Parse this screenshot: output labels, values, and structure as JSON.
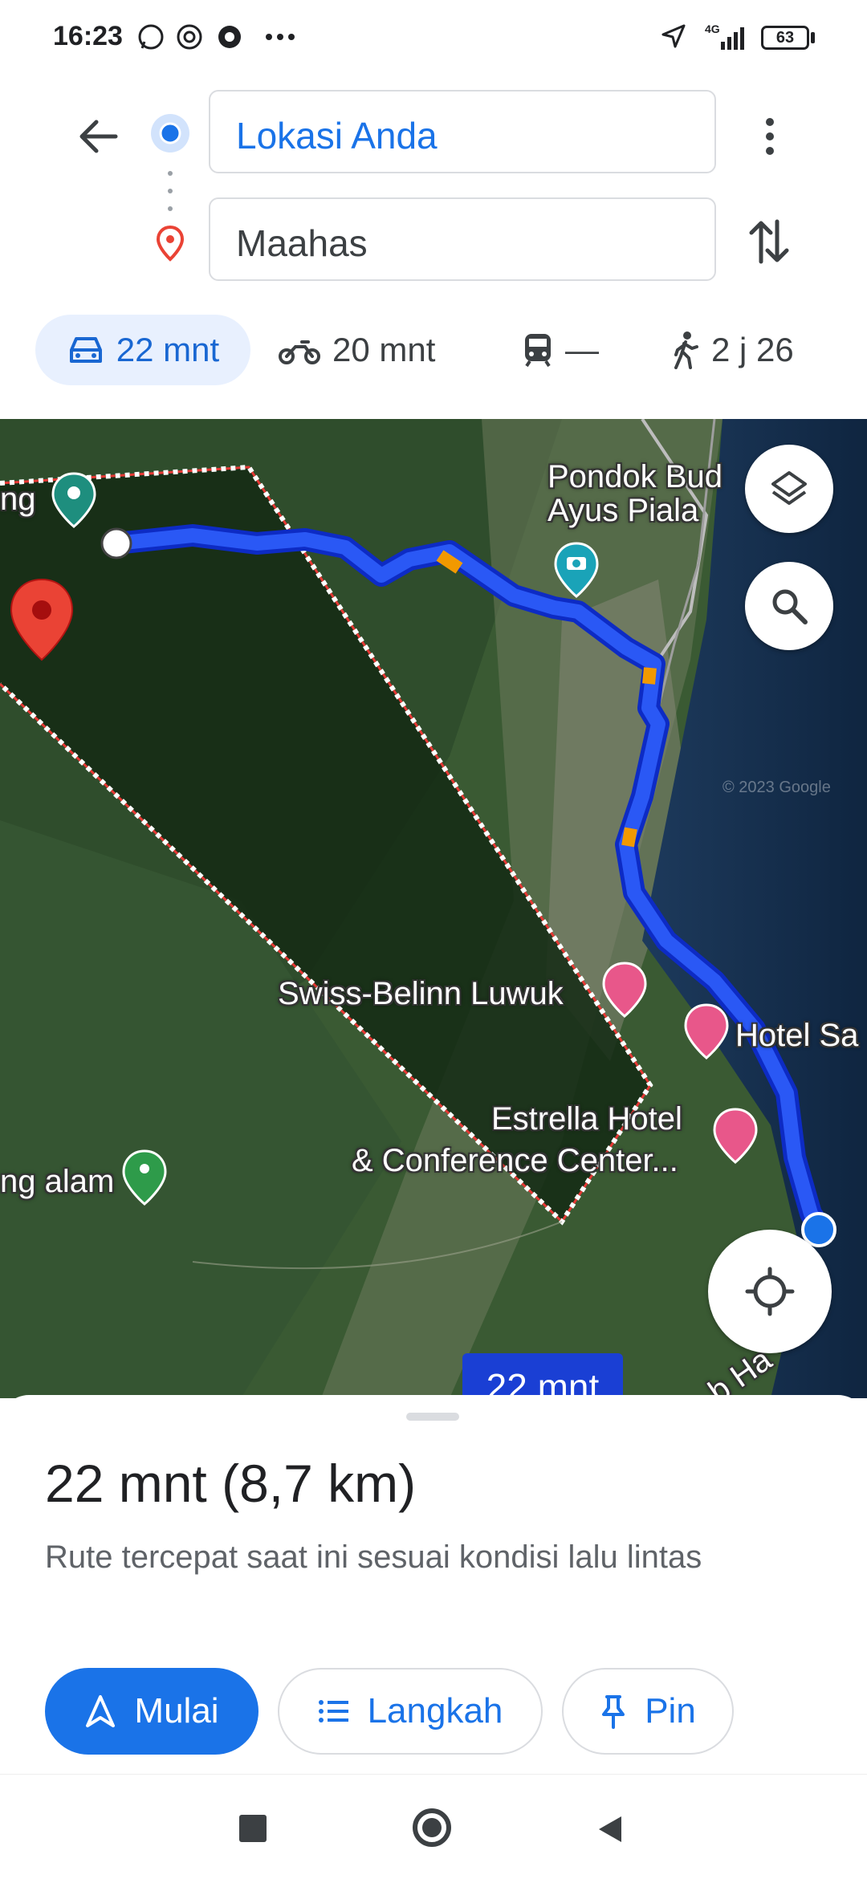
{
  "status_bar": {
    "time": "16:23",
    "network": "4G",
    "battery": "63",
    "icons": [
      "whatsapp-icon",
      "threads-icon",
      "chrome-icon",
      "more-dots-icon",
      "location-arrow-icon",
      "signal-icon",
      "battery-icon"
    ]
  },
  "header": {
    "origin": "Lokasi Anda",
    "destination": "Maahas",
    "icons": [
      "back-arrow-icon",
      "origin-dot-icon",
      "destination-pin-icon",
      "more-vert-icon",
      "swap-icon"
    ]
  },
  "modes": [
    {
      "name": "car",
      "label": "22 mnt",
      "selected": true,
      "icon": "car-icon"
    },
    {
      "name": "motorcycle",
      "label": "20 mnt",
      "icon": "motorcycle-icon"
    },
    {
      "name": "transit",
      "label": "—",
      "icon": "train-icon"
    },
    {
      "name": "walk",
      "label": "2 j 26",
      "icon": "walk-icon"
    }
  ],
  "map": {
    "labels": {
      "ng": "ng",
      "pondok_1": "Pondok Bud",
      "pondok_2": "Ayus Piala",
      "copyright": "© 2023 Google",
      "swiss": "Swiss-Belinn Luwuk",
      "hotel_sa": "Hotel Sa",
      "estrella_1": "Estrella Hotel",
      "estrella_2": "& Conference Center...",
      "ng_alam": "ng alam",
      "road": "b Ha"
    },
    "route_badge": "22 mnt",
    "colors": {
      "route": "#1a3fd4",
      "traffic_slow": "#f29900",
      "destination_pin": "#ea4335",
      "hotel_pin": "#e8578a",
      "park_pin": "#1e8e7e"
    }
  },
  "sheet": {
    "summary": "22 mnt (8,7 km)",
    "subtitle": "Rute tercepat saat ini sesuai kondisi lalu lintas",
    "buttons": {
      "start": "Mulai",
      "steps": "Langkah",
      "pin": "Pin"
    },
    "accent": "#1a73e8"
  }
}
